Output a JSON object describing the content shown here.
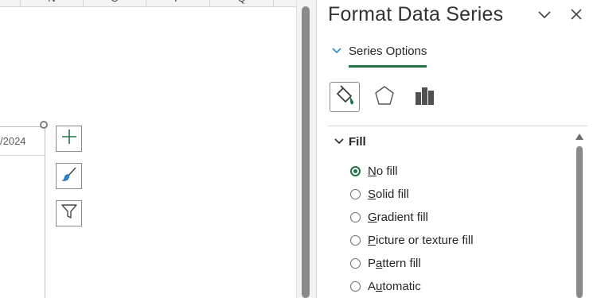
{
  "sheet": {
    "columns": [
      "N",
      "O",
      "P",
      "Q"
    ],
    "chart_date_fragment": "/2024"
  },
  "chart_buttons": [
    {
      "icon": "plus-icon",
      "label": "Chart Elements"
    },
    {
      "icon": "brush-icon",
      "label": "Chart Styles"
    },
    {
      "icon": "filter-icon",
      "label": "Chart Filters"
    }
  ],
  "panel": {
    "title": "Format Data Series",
    "series_options_label": "Series Options",
    "tabs": [
      {
        "icon": "fill-line-icon",
        "active": true
      },
      {
        "icon": "effects-icon",
        "active": false
      },
      {
        "icon": "series-options-icon",
        "active": false
      }
    ],
    "section": "Fill",
    "fill_options": [
      {
        "pre": "",
        "u": "N",
        "post": "o fill",
        "checked": true
      },
      {
        "pre": "",
        "u": "S",
        "post": "olid fill",
        "checked": false
      },
      {
        "pre": "",
        "u": "G",
        "post": "radient fill",
        "checked": false
      },
      {
        "pre": "",
        "u": "P",
        "post": "icture or texture fill",
        "checked": false
      },
      {
        "pre": "P",
        "u": "a",
        "post": "ttern fill",
        "checked": false
      },
      {
        "pre": "A",
        "u": "u",
        "post": "tomatic",
        "checked": false
      }
    ],
    "accent_color": "#217346"
  }
}
